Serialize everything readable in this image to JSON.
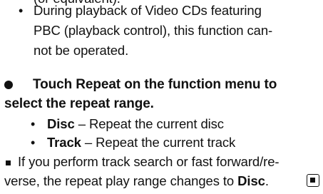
{
  "top_fragment": "(or equivalent).",
  "pbc_note": {
    "line1": "During playback of Video CDs featuring",
    "line2": "PBC (playback control), this function can-",
    "line3": "not be operated."
  },
  "step_heading": {
    "line1": "Touch Repeat on the function menu to",
    "line2": "select the repeat range."
  },
  "options": [
    {
      "term": "Disc",
      "separator": " – ",
      "description": "Repeat the current disc"
    },
    {
      "term": "Track",
      "separator": " – ",
      "description": "Repeat the current track"
    }
  ],
  "note": {
    "line1": "If you perform track search or fast forward/re-",
    "line2_prefix": "verse, the repeat play range changes to ",
    "line2_term": "Disc",
    "line2_suffix": "."
  }
}
